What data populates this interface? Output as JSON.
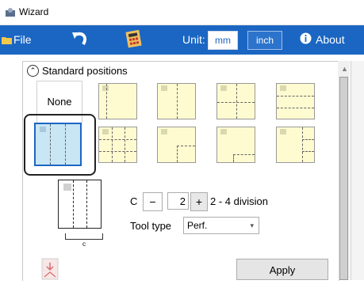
{
  "window": {
    "title": "Wizard"
  },
  "toolbar": {
    "file_label": "File",
    "unit_label": "Unit:",
    "unit_options": [
      "mm",
      "inch"
    ],
    "selected_unit": "mm",
    "about_label": "About"
  },
  "standard_positions": {
    "header": "Standard positions",
    "none_label": "None",
    "layouts": [
      "left-vertical-line",
      "center-vertical-line",
      "cross",
      "two-horizontal-lines",
      "two-vertical-lines-selected",
      "grid-3x3",
      "corner-l",
      "bottom-right-step",
      "right-small-lines"
    ],
    "selected": "two-vertical-lines-selected"
  },
  "division": {
    "c_label": "C",
    "minus_label": "−",
    "value": "2",
    "plus_label": "+",
    "range_label": "2 - 4 division",
    "bracket_label": "c"
  },
  "tool_type": {
    "label": "Tool type",
    "value": "Perf."
  },
  "apply_label": "Apply",
  "colors": {
    "toolbar_bg": "#1b66c3",
    "thumb_bg": "#fffbd0",
    "selected_bg": "#c9e6f5"
  }
}
